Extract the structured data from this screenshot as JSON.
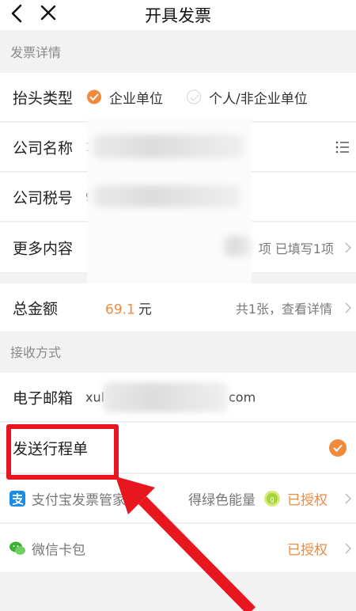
{
  "nav": {
    "title": "开具发票"
  },
  "sections": {
    "invoice_details": "发票详情",
    "receive_method": "接收方式"
  },
  "header_type": {
    "label": "抬头类型",
    "option_company": "企业单位",
    "option_personal": "个人/非企业单位",
    "selected": "企业单位"
  },
  "company_name": {
    "label": "公司名称",
    "value_prefix": "1"
  },
  "tax_id": {
    "label": "公司税号",
    "value_prefix": "9"
  },
  "more": {
    "label": "更多内容",
    "summary": "项 已填写1项"
  },
  "total": {
    "label": "总金额",
    "amount": "69.1",
    "unit": "元",
    "detail": "共1张，查看详情"
  },
  "email": {
    "label": "电子邮箱",
    "value_start": "xul",
    "value_end": "com"
  },
  "itinerary": {
    "label": "发送行程单",
    "checked": true
  },
  "alipay": {
    "label": "支付宝发票管家",
    "energy": "得绿色能量",
    "status": "已授权"
  },
  "wechat": {
    "label": "微信卡包",
    "status": "已授权"
  },
  "colors": {
    "accent": "#f08a3c",
    "highlight": "#e8161e"
  }
}
